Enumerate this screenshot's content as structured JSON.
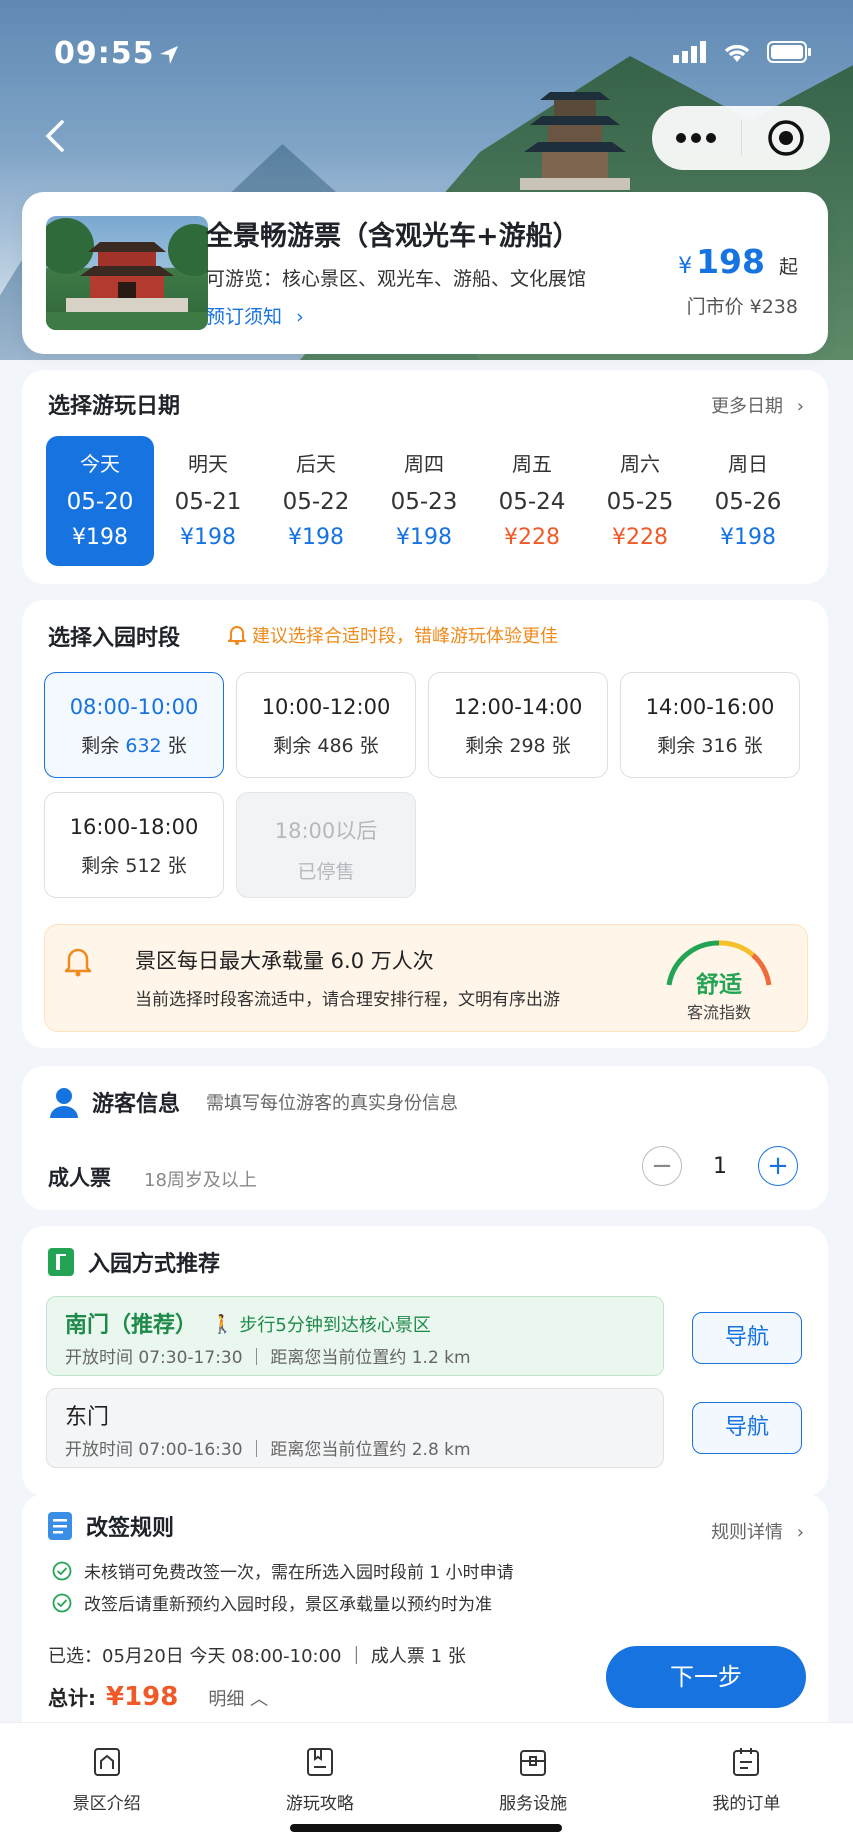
{
  "status": {
    "time": "09:55"
  },
  "product": {
    "title": "全景畅游票（含观光车+游船）",
    "subtitle": "可游览：核心景区、观光车、游船、文化展馆",
    "notice_link": "预订须知",
    "price_symbol": "¥",
    "price": "198",
    "price_suffix": "起",
    "market_price": "门市价 ¥238"
  },
  "date_section": {
    "title": "选择游玩日期",
    "more": "更多日期",
    "dates": [
      {
        "label": "今天",
        "date": "05-20",
        "price": "¥198"
      },
      {
        "label": "明天",
        "date": "05-21",
        "price": "¥198"
      },
      {
        "label": "后天",
        "date": "05-22",
        "price": "¥198"
      },
      {
        "label": "周四",
        "date": "05-23",
        "price": "¥198"
      },
      {
        "label": "周五",
        "date": "05-24",
        "price": "¥228"
      },
      {
        "label": "周六",
        "date": "05-25",
        "price": "¥228"
      },
      {
        "label": "周日",
        "date": "05-26",
        "price": "¥198"
      }
    ]
  },
  "time_section": {
    "title": "选择入园时段",
    "tip": "建议选择合适时段，错峰游玩体验更佳",
    "slots": [
      {
        "time": "08:00-10:00",
        "prefix": "剩余",
        "count": "632",
        "suffix": "张"
      },
      {
        "time": "10:00-12:00",
        "prefix": "剩余",
        "count": "486",
        "suffix": "张"
      },
      {
        "time": "12:00-14:00",
        "prefix": "剩余",
        "count": "298",
        "suffix": "张"
      },
      {
        "time": "14:00-16:00",
        "prefix": "剩余",
        "count": "316",
        "suffix": "张"
      },
      {
        "time": "16:00-18:00",
        "prefix": "剩余",
        "count": "512",
        "suffix": "张"
      },
      {
        "time": "18:00以后",
        "status": "已停售"
      }
    ],
    "notice_title": "景区每日最大承载量 6.0 万人次",
    "notice_desc": "当前选择时段客流适中，请合理安排行程，文明有序出游",
    "gauge_label": "舒适",
    "gauge_sub": "客流指数"
  },
  "visitor": {
    "title": "游客信息",
    "subtitle": "需填写每位游客的真实身份信息",
    "ticket_type": "成人票",
    "ticket_desc": "18周岁及以上",
    "quantity": "1",
    "minus": "−",
    "plus": "+"
  },
  "gates": {
    "title": "入园方式推荐",
    "south": {
      "name": "南门（推荐）",
      "walk": "步行5分钟到达核心景区",
      "info": "开放时间 07:30-17:30 ｜ 距离您当前位置约 1.2 km",
      "nav": "导航"
    },
    "east": {
      "name": "东门",
      "info": "开放时间 07:00-16:30 ｜ 距离您当前位置约 2.8 km",
      "nav": "导航"
    }
  },
  "rules": {
    "title": "改签规则",
    "more": "规则详情",
    "items": [
      "未核销可免费改签一次，需在所选入园时段前 1 小时申请",
      "改签后请重新预约入园时段，景区承载量以预约时为准"
    ]
  },
  "summary": {
    "selected": "已选：05月20日 今天 08:00-10:00 ｜ 成人票 1 张",
    "total_label": "总计:",
    "total_price": "¥198",
    "detail": "明细 ︿",
    "next": "下一步"
  },
  "tabs": [
    {
      "label": "景区介绍",
      "icon": "scenic-intro-icon"
    },
    {
      "label": "游玩攻略",
      "icon": "guide-book-icon"
    },
    {
      "label": "服务设施",
      "icon": "facility-icon"
    },
    {
      "label": "我的订单",
      "icon": "order-icon"
    }
  ],
  "colors": {
    "primary": "#1673e0",
    "accent_red": "#f05a28",
    "green": "#22a454",
    "warn": "#f08a1c"
  }
}
